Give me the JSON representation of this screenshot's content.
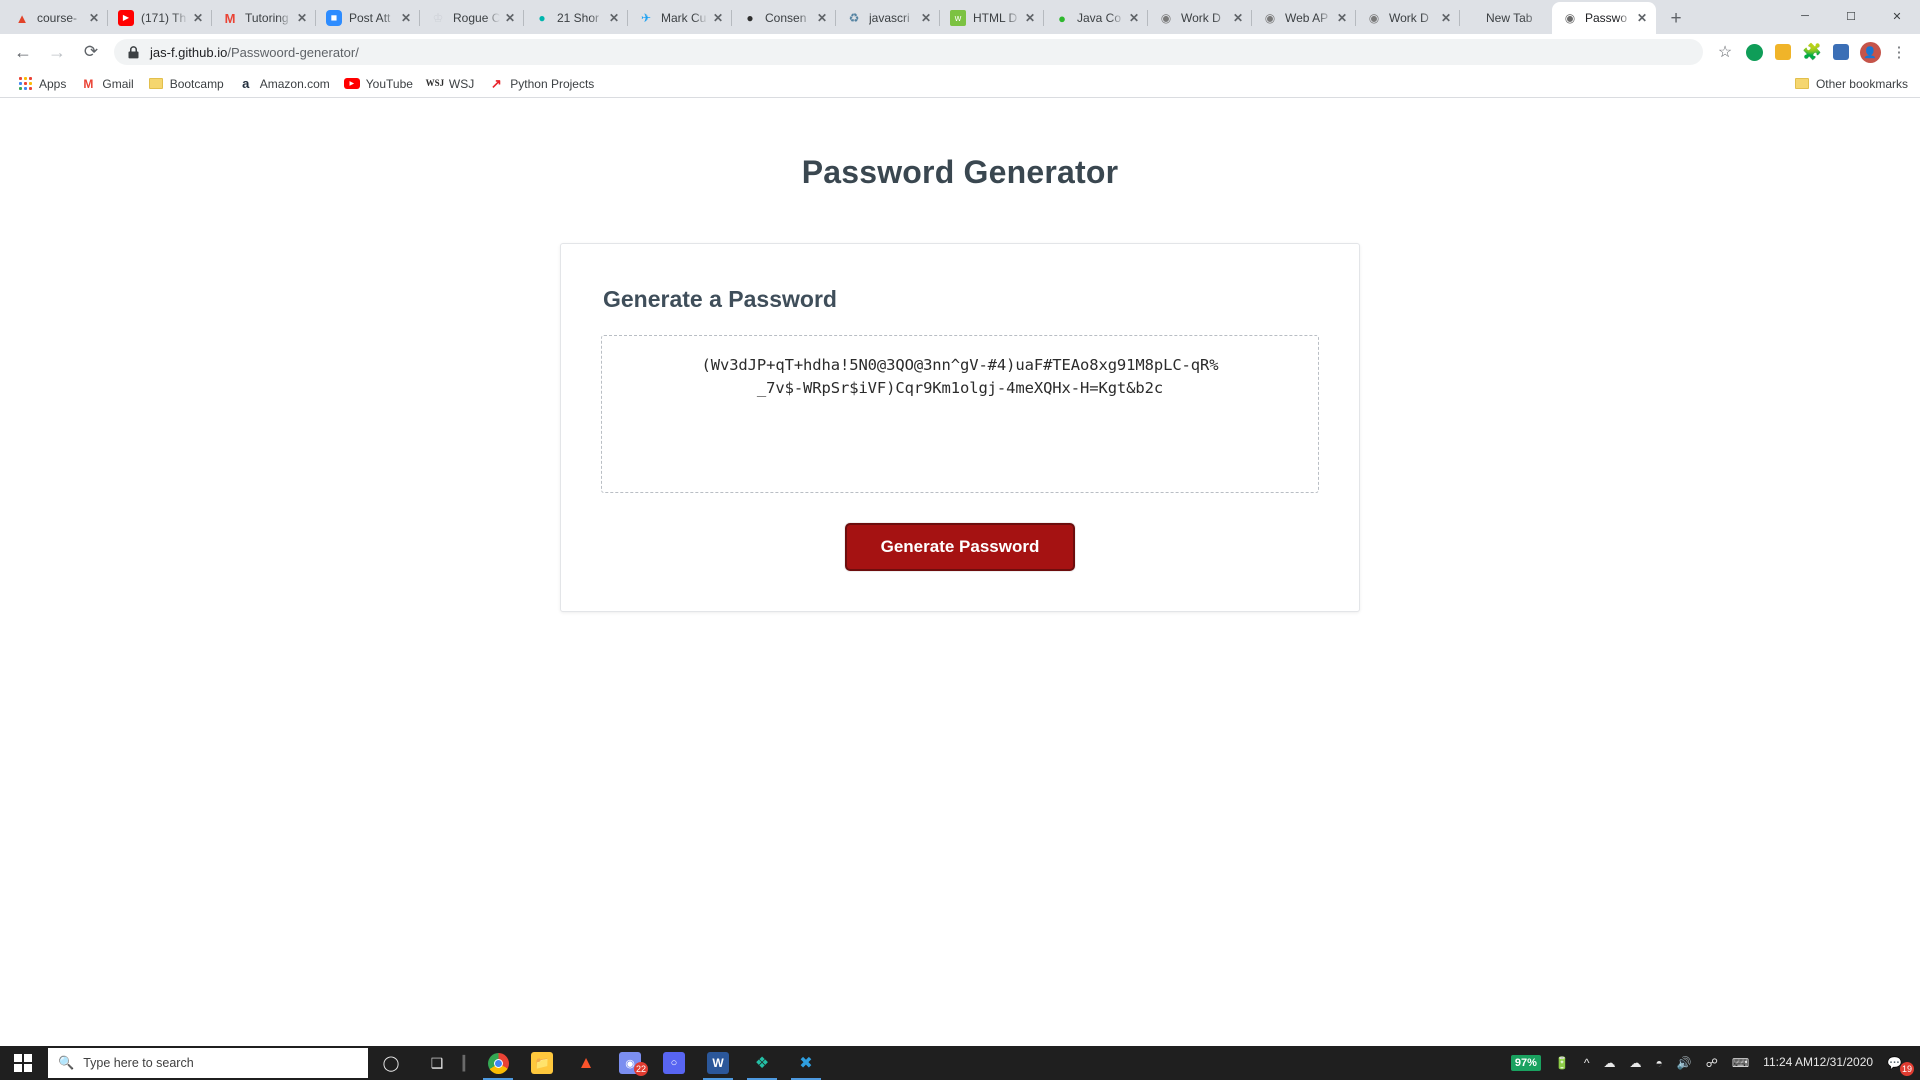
{
  "browser": {
    "tabs": [
      {
        "title": "course-",
        "favicon": "gitlab-icon",
        "color": "#e24329",
        "glyph": "🦊",
        "active": false
      },
      {
        "title": "(171) Th",
        "favicon": "youtube-icon",
        "color": "#ff0000",
        "glyph": "▶",
        "active": false
      },
      {
        "title": "Tutoring",
        "favicon": "gmail-icon",
        "color": "#ea4335",
        "glyph": "M",
        "active": false
      },
      {
        "title": "Post Att",
        "favicon": "zoom-icon",
        "color": "#2d8cff",
        "glyph": "▣",
        "active": false
      },
      {
        "title": "Rogue C",
        "favicon": "rogue-icon",
        "color": "#c8c8d0",
        "glyph": "W",
        "active": false
      },
      {
        "title": "21 Shor",
        "favicon": "teal-drop-icon",
        "color": "#00b5ad",
        "glyph": "▮",
        "active": false
      },
      {
        "title": "Mark Cu",
        "favicon": "twitter-icon",
        "color": "#1da1f2",
        "glyph": "🐦",
        "active": false
      },
      {
        "title": "Consen",
        "favicon": "ink-drop-icon",
        "color": "#2f2f2f",
        "glyph": "◍",
        "active": false
      },
      {
        "title": "javascri",
        "favicon": "java-icon",
        "color": "#5382a1",
        "glyph": "J",
        "active": false
      },
      {
        "title": "HTML D",
        "favicon": "html-green-icon",
        "color": "#7cc242",
        "glyph": "w",
        "active": false
      },
      {
        "title": "Java Co",
        "favicon": "java-green-icon",
        "color": "#2eb82e",
        "glyph": "B",
        "active": false
      },
      {
        "title": "Work D",
        "favicon": "globe-icon",
        "color": "#808080",
        "glyph": "🌐",
        "active": false
      },
      {
        "title": "Web AP",
        "favicon": "globe-icon",
        "color": "#808080",
        "glyph": "🌐",
        "active": false
      },
      {
        "title": "Work D",
        "favicon": "globe-icon",
        "color": "#808080",
        "glyph": "🌐",
        "active": false
      },
      {
        "title": "New Tab",
        "favicon": "none",
        "color": "transparent",
        "glyph": "",
        "active": false
      },
      {
        "title": "Passwo",
        "favicon": "globe-icon",
        "color": "#707070",
        "glyph": "🌐",
        "active": true
      }
    ],
    "new_tab_label": "+",
    "window_controls": {
      "minimize": "─",
      "maximize": "☐",
      "close": "✕"
    },
    "nav": {
      "back": "←",
      "forward": "→",
      "reload": "⟳"
    },
    "omnibox": {
      "lock": "🔒",
      "url_host": "jas-f.github.io",
      "url_path": "/Passwoord-generator/"
    },
    "toolbar_icons": [
      "star-icon",
      "extension-green-icon",
      "extension-yellow-icon",
      "puzzle-icon",
      "extension-blue-icon",
      "profile-avatar",
      "more-menu-icon"
    ],
    "bookmarks": [
      {
        "label": "Apps",
        "icon": "apps-grid-icon"
      },
      {
        "label": "Gmail",
        "icon": "gmail-icon"
      },
      {
        "label": "Bootcamp",
        "icon": "folder-icon"
      },
      {
        "label": "Amazon.com",
        "icon": "amazon-icon"
      },
      {
        "label": "YouTube",
        "icon": "youtube-icon"
      },
      {
        "label": "WSJ",
        "icon": "wsj-icon"
      },
      {
        "label": "Python Projects",
        "icon": "red-arrow-icon"
      }
    ],
    "other_bookmarks": {
      "label": "Other bookmarks",
      "icon": "folder-icon"
    }
  },
  "page": {
    "title": "Password Generator",
    "card_title": "Generate a Password",
    "password": "(Wv3dJP+qT+hdha!5N0@3QO@3nn^gV-#4)uaF#TEAo8xg91M8pLC-qR%_7v$-WRpSr$iVF)Cqr9Km1olgj-4meXQHx-H=Kgt&b2c",
    "generate_button": "Generate Password",
    "accent_color": "#a51212"
  },
  "taskbar": {
    "start": "windows-logo",
    "search_placeholder": "Type here to search",
    "search_icon": "magnifier-icon",
    "buttons": [
      {
        "name": "cortana-icon",
        "glyph": "◯"
      },
      {
        "name": "task-view-icon",
        "glyph": "❑"
      },
      {
        "name": "divider",
        "glyph": "▎"
      }
    ],
    "apps": [
      {
        "name": "chrome-icon",
        "glyph": "",
        "color": "#ffffff",
        "active": true
      },
      {
        "name": "file-explorer-icon",
        "glyph": "📁",
        "color": "#ffc83d",
        "active": false
      },
      {
        "name": "brave-icon",
        "glyph": "🦁",
        "color": "#fb542b",
        "active": false
      },
      {
        "name": "discord-icon",
        "glyph": "◍",
        "color": "#5865f2",
        "active": false,
        "badge": "22"
      },
      {
        "name": "discord2-icon",
        "glyph": "◌",
        "color": "#5865f2",
        "active": false
      },
      {
        "name": "word-icon",
        "glyph": "W",
        "color": "#2b579a",
        "active": true
      },
      {
        "name": "vscode-insiders-icon",
        "glyph": "◆",
        "color": "#24bfa5",
        "active": true
      },
      {
        "name": "vscode-icon",
        "glyph": "✕",
        "color": "#0078d4",
        "active": true
      }
    ],
    "tray": {
      "battery_percent": "97%",
      "icons": [
        "battery-icon",
        "chevron-up-icon",
        "onedrive-icon",
        "cloud-icon",
        "wifi-icon",
        "volume-icon",
        "bluetooth-icon",
        "keyboard-icon"
      ],
      "time": "11:24 AM",
      "date": "12/31/2020",
      "notification_count": "19"
    }
  }
}
